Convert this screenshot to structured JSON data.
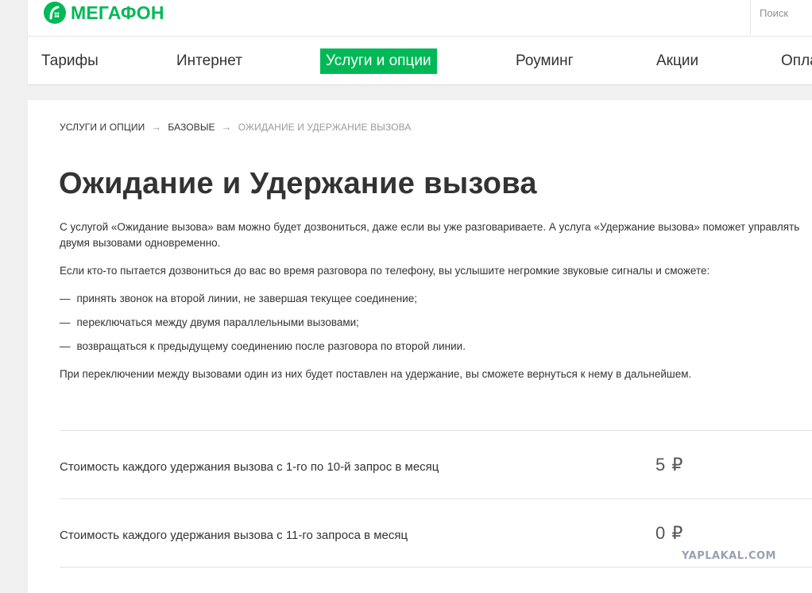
{
  "brand": {
    "name": "МегаФон",
    "color": "#00b956",
    "logo_icon": "megafon-logo-icon"
  },
  "header": {
    "search_label": "Поиск",
    "nav": [
      {
        "label": "Тарифы",
        "active": false
      },
      {
        "label": "Интернет",
        "active": false
      },
      {
        "label": "Услуги и опции",
        "active": true
      },
      {
        "label": "Роуминг",
        "active": false
      },
      {
        "label": "Акции",
        "active": false
      },
      {
        "label": "Опла",
        "active": false
      }
    ]
  },
  "breadcrumb": {
    "items": [
      "УСЛУГИ И ОПЦИИ",
      "БАЗОВЫЕ",
      "ОЖИДАНИЕ И УДЕРЖАНИЕ ВЫЗОВА"
    ],
    "separator": "→"
  },
  "page": {
    "title": "Ожидание и Удержание вызова",
    "intro": "С услугой «Ожидание вызова» вам можно будет дозвониться, даже если вы уже разговариваете. А услуга «Удержание вызова» поможет управлять двумя вызовами одновременно.",
    "lead": "Если кто-то пытается дозвониться до вас во время разговора по телефону, вы услышите негромкие звуковые сигналы и сможете:",
    "bullet_marker": "—",
    "bullets": [
      "принять звонок на второй линии, не завершая текущее соединение;",
      "переключаться между двумя параллельными вызовами;",
      "возвращаться к предыдущему соединению после разговора по второй линии."
    ],
    "note": "При переключении между вызовами один из них будет поставлен на удержание, вы сможете вернуться к нему в дальнейшем."
  },
  "prices": [
    {
      "label": "Стоимость каждого удержания вызова с 1-го по 10-й запрос в месяц",
      "value": "5 ₽"
    },
    {
      "label": "Стоимость каждого удержания вызова с 11-го запроса в месяц",
      "value": "0 ₽"
    }
  ],
  "watermark": "YAPLAKAL.COM"
}
